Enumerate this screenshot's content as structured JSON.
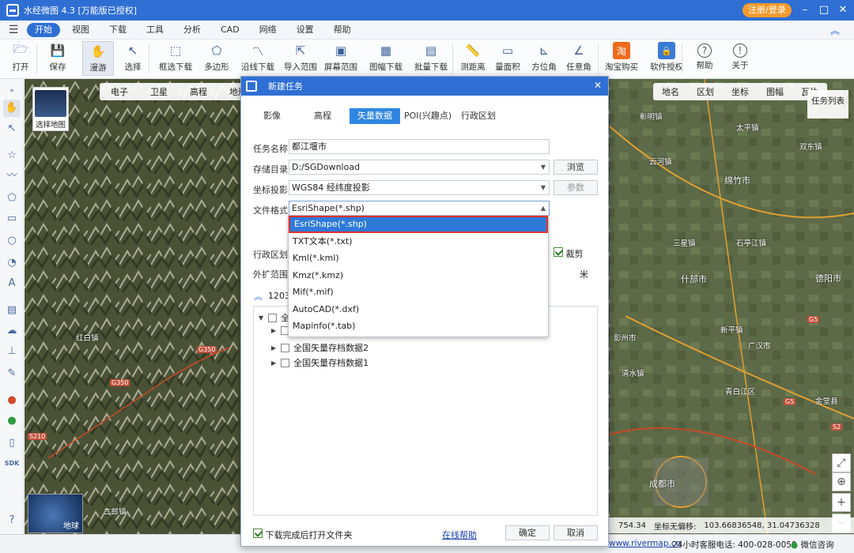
{
  "window": {
    "title": "水经微图 4.3 [万能版已授权]",
    "login_label": "注册/登录"
  },
  "menu": [
    "开始",
    "视图",
    "下载",
    "工具",
    "分析",
    "CAD",
    "网络",
    "设置",
    "帮助"
  ],
  "toolbar": [
    {
      "label": "打开",
      "icon": "folder-icon"
    },
    {
      "label": "保存",
      "icon": "save-icon"
    },
    {
      "label": "漫游",
      "icon": "hand-icon"
    },
    {
      "label": "选择",
      "icon": "cursor-icon"
    },
    {
      "label": "框选下载",
      "icon": "box-download-icon"
    },
    {
      "label": "多边形",
      "icon": "polygon-icon"
    },
    {
      "label": "沿线下载",
      "icon": "line-download-icon"
    },
    {
      "label": "导入范围",
      "icon": "import-icon"
    },
    {
      "label": "屏幕范围",
      "icon": "screen-icon"
    },
    {
      "label": "图幅下载",
      "icon": "sheet-download-icon"
    },
    {
      "label": "批量下载",
      "icon": "batch-download-icon"
    },
    {
      "label": "测距离",
      "icon": "ruler-icon"
    },
    {
      "label": "量面积",
      "icon": "area-icon"
    },
    {
      "label": "方位角",
      "icon": "azimuth-icon"
    },
    {
      "label": "任意角",
      "icon": "angle-icon"
    },
    {
      "label": "淘宝购买",
      "icon": "taobao-icon"
    },
    {
      "label": "软件授权",
      "icon": "license-icon"
    },
    {
      "label": "帮助",
      "icon": "help-icon"
    },
    {
      "label": "关于",
      "icon": "info-icon"
    }
  ],
  "map": {
    "left_tabs": [
      "电子",
      "卫星",
      "高程",
      "地形"
    ],
    "right_tabs": [
      "地名",
      "区划",
      "坐标",
      "图幅",
      "瓦片"
    ],
    "select_map_label": "选择地图",
    "task_list_label": "任务列表",
    "globe_label": "地球",
    "labels": [
      "彰明镇",
      "太平镇",
      "云河镇",
      "双东镇",
      "绵竹市",
      "什邡市",
      "德阳市",
      "新平镇",
      "成都市",
      "青白江区",
      "广汉市",
      "金堂县",
      "二郎镇",
      "红白镇",
      "清水镇",
      "彭州市",
      "三星镇",
      "石亭江镇"
    ],
    "roads": [
      "G350",
      "G350",
      "G5",
      "G5",
      "S210",
      "S2"
    ],
    "status": {
      "zoom": "754.34",
      "offset_label": "坐标无偏移:",
      "coords": "103.66836548, 31.04736328"
    }
  },
  "footer": {
    "site": "www.rivermap.cn",
    "service": "24小时客服电话: 400-028-0050",
    "wechat": "微信咨询"
  },
  "dialog": {
    "title": "新建任务",
    "tabs": [
      "影像",
      "高程",
      "矢量数据",
      "POI(兴趣点)",
      "行政区划"
    ],
    "active_tab": "矢量数据",
    "fields": {
      "task_name_label": "任务名称:",
      "task_name": "都江堰市",
      "save_dir_label": "存储目录:",
      "save_dir": "D:/SGDownload",
      "browse": "浏览",
      "projection_label": "坐标投影:",
      "projection": "WGS84 经纬度投影",
      "params": "参数",
      "format_label": "文件格式:",
      "format": "EsriShape(*.shp)",
      "region_label": "行政区划:",
      "clip_label": "裁剪",
      "buffer_label": "外扩范围:",
      "buffer_unit": "米",
      "count_prefix": "1203."
    },
    "format_options": [
      "EsriShape(*.shp)",
      "TXT文本(*.txt)",
      "Kml(*.kml)",
      "Kmz(*.kmz)",
      "Mif(*.mif)",
      "AutoCAD(*.dxf)",
      "Mapinfo(*.tab)"
    ],
    "tree": [
      {
        "label": "全国",
        "expanded": true
      },
      {
        "label": "全国矢量存档数据2"
      },
      {
        "label": "全国矢量存档数据1"
      }
    ],
    "open_folder_label": "下载完成后打开文件夹",
    "help_link": "在线帮助",
    "ok": "确定",
    "cancel": "取消"
  }
}
